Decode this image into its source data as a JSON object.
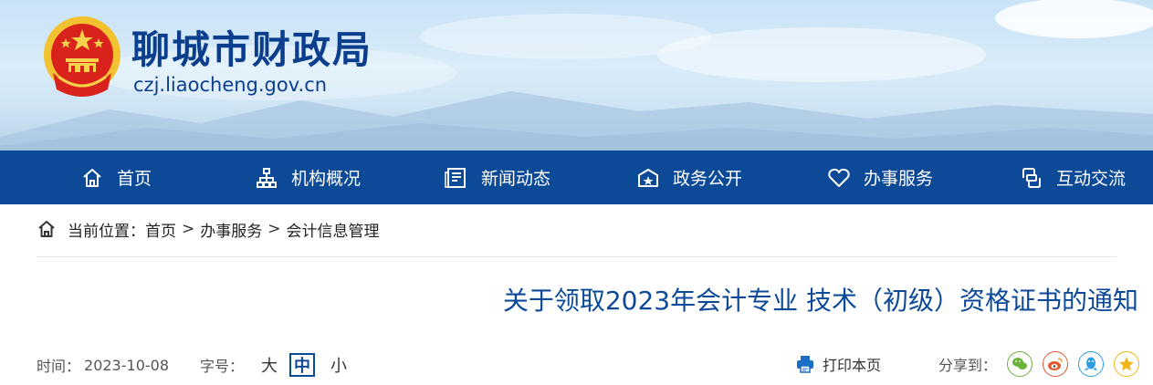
{
  "site": {
    "name": "聊城市财政局",
    "domain": "czj.liaocheng.gov.cn",
    "emblem_icon": "national-emblem-icon"
  },
  "nav": {
    "items": [
      {
        "label": "首页",
        "icon": "home-icon"
      },
      {
        "label": "机构概况",
        "icon": "org-chart-icon"
      },
      {
        "label": "新闻动态",
        "icon": "news-icon"
      },
      {
        "label": "政务公开",
        "icon": "gov-affairs-icon"
      },
      {
        "label": "办事服务",
        "icon": "heart-icon"
      },
      {
        "label": "互动交流",
        "icon": "interaction-icon"
      }
    ]
  },
  "breadcrumb": {
    "prefix": "当前位置：",
    "items": [
      "首页",
      "办事服务",
      "会计信息管理"
    ],
    "separator": ">"
  },
  "article": {
    "title": "关于领取2023年会计专业 技术（初级）资格证书的通知",
    "time_label": "时间：",
    "date": "2023-10-08",
    "font_size_label": "字号：",
    "font_sizes": {
      "large": "大",
      "medium": "中",
      "small": "小"
    },
    "selected_font_size": "中"
  },
  "tools": {
    "print_label": "打印本页",
    "share_label": "分享到："
  },
  "colors": {
    "nav_bg": "#0c4a98",
    "title": "#0c4a98",
    "accent": "#0b3f8e"
  }
}
